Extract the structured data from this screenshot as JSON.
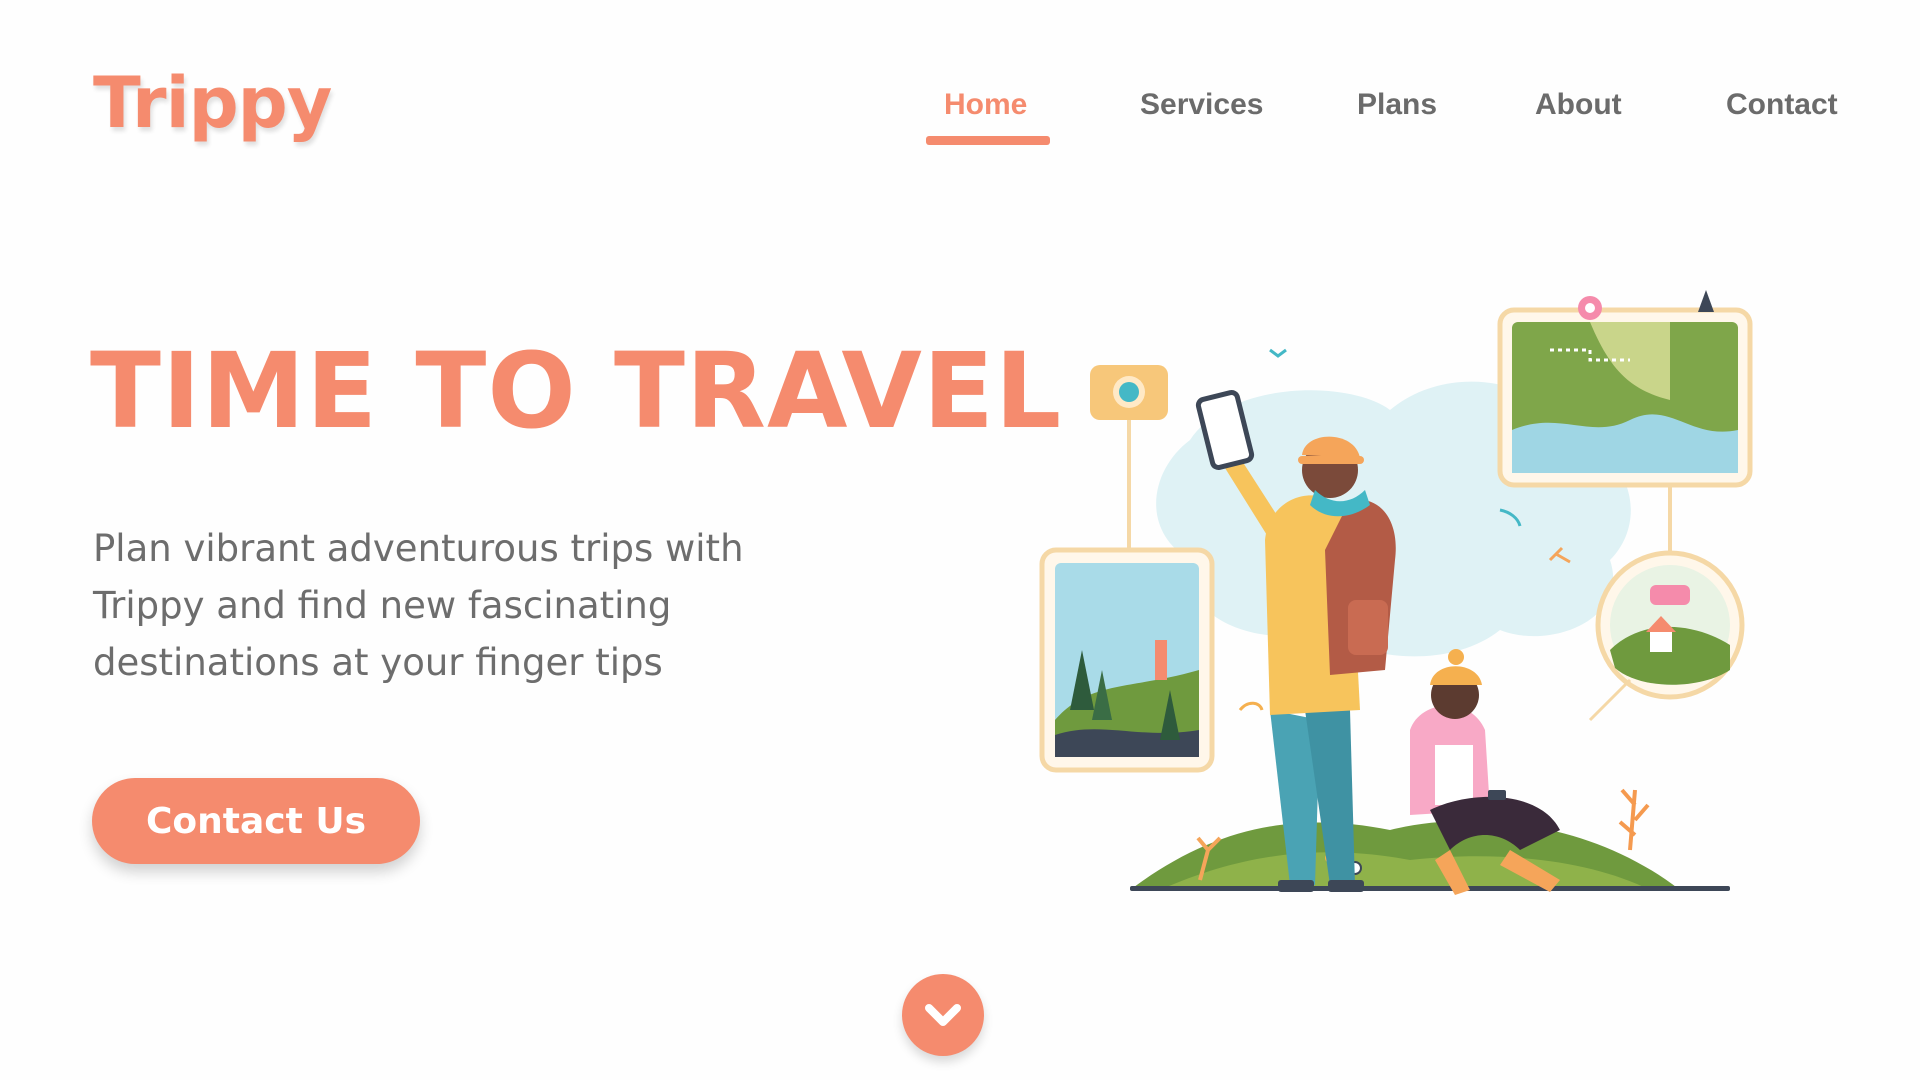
{
  "brand": {
    "name": "Trippy"
  },
  "nav": {
    "items": [
      {
        "label": "Home",
        "active": true
      },
      {
        "label": "Services",
        "active": false
      },
      {
        "label": "Plans",
        "active": false
      },
      {
        "label": "About",
        "active": false
      },
      {
        "label": "Contact",
        "active": false
      }
    ]
  },
  "hero": {
    "title": "TIME TO TRAVEL",
    "description_lines": [
      "Plan vibrant adventurous trips with",
      "Trippy and find new fascinating",
      "destinations at your finger tips"
    ],
    "cta_label": "Contact Us"
  },
  "icons": {
    "scroll": "chevron-down-icon"
  },
  "colors": {
    "accent": "#f58b6e",
    "text_muted": "#6d6d6d",
    "nav_text": "#6b6b6b",
    "background": "#ffffff"
  }
}
